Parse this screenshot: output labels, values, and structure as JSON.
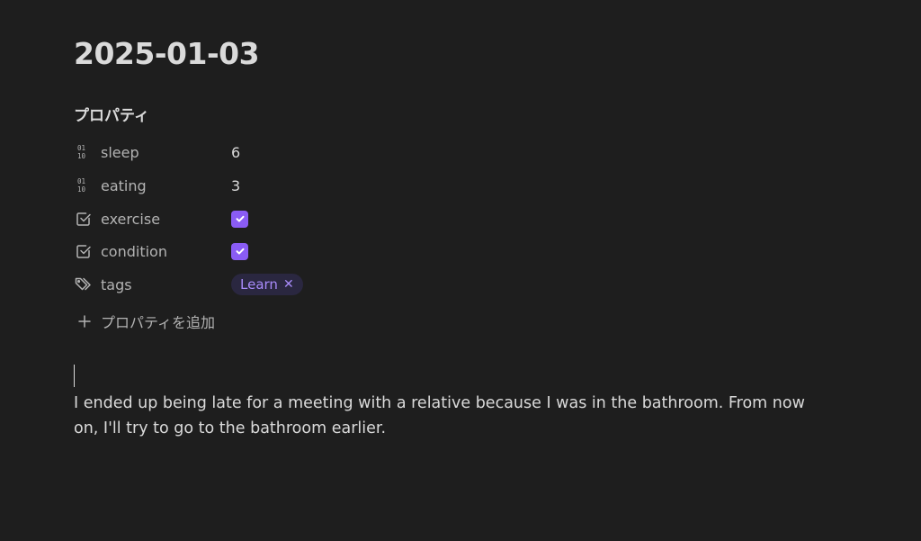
{
  "note": {
    "title": "2025-01-03",
    "properties_heading": "プロパティ",
    "properties": [
      {
        "icon": "number-icon",
        "key": "sleep",
        "type": "number",
        "value": "6"
      },
      {
        "icon": "number-icon",
        "key": "eating",
        "type": "number",
        "value": "3"
      },
      {
        "icon": "checkbox-icon",
        "key": "exercise",
        "type": "checkbox",
        "checked": true
      },
      {
        "icon": "checkbox-icon",
        "key": "condition",
        "type": "checkbox",
        "checked": true
      },
      {
        "icon": "tags-icon",
        "key": "tags",
        "type": "tags",
        "tags": [
          "Learn"
        ]
      }
    ],
    "add_property_label": "プロパティを追加",
    "body": "I ended up being late for a meeting with a relative because I was in the bathroom. From now on, I'll try to go to the bathroom earlier."
  },
  "colors": {
    "background": "#1e1e1e",
    "text": "#dadada",
    "muted": "#b3b3b3",
    "accent": "#8a5cf5",
    "tag_bg": "#2a2740",
    "tag_text": "#a88bfa"
  }
}
